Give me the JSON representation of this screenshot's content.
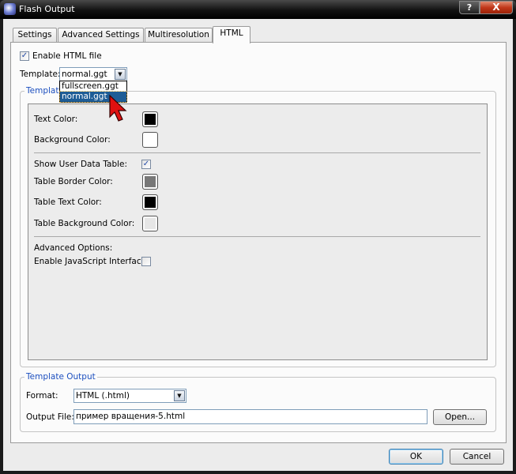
{
  "window": {
    "title": "Flash Output",
    "help_label": "?",
    "close_label": "X"
  },
  "tabs": [
    {
      "label": "Settings"
    },
    {
      "label": "Advanced Settings"
    },
    {
      "label": "Multiresolution"
    },
    {
      "label": "HTML",
      "active": true
    }
  ],
  "html_tab": {
    "enable_html": {
      "label": "Enable HTML file",
      "checked": true,
      "check_glyph": "✓"
    },
    "template": {
      "label": "Template:",
      "value": "normal.ggt",
      "options": [
        "fullscreen.ggt",
        "normal.ggt"
      ],
      "selected_option": "normal.ggt",
      "dropdown_open": true
    },
    "template_group": {
      "legend": "Template",
      "text_color": {
        "label": "Text Color:",
        "color": "#000000"
      },
      "background_color": {
        "label": "Background Color:",
        "color": "#ffffff"
      },
      "show_user_data_table": {
        "label": "Show User Data Table:",
        "checked": true
      },
      "table_border_color": {
        "label": "Table Border Color:",
        "color": "#777777"
      },
      "table_text_color": {
        "label": "Table Text Color:",
        "color": "#000000"
      },
      "table_background_color": {
        "label": "Table Background Color:",
        "color": "#e6e6e6"
      },
      "advanced_options": {
        "label": "Advanced Options:"
      },
      "enable_js_interface": {
        "label": "Enable JavaScript Interface:",
        "checked": false
      }
    },
    "output_group": {
      "legend": "Template Output",
      "format": {
        "label": "Format:",
        "value": "HTML (.html)"
      },
      "output_file": {
        "label": "Output File:",
        "value": "пример вращения-5.html"
      },
      "open_label": "Open..."
    }
  },
  "footer": {
    "ok_label": "OK",
    "cancel_label": "Cancel"
  },
  "colors": {
    "accent": "#1c4fbf",
    "selection": "#1e5d96",
    "close_red": "#c2381a"
  }
}
